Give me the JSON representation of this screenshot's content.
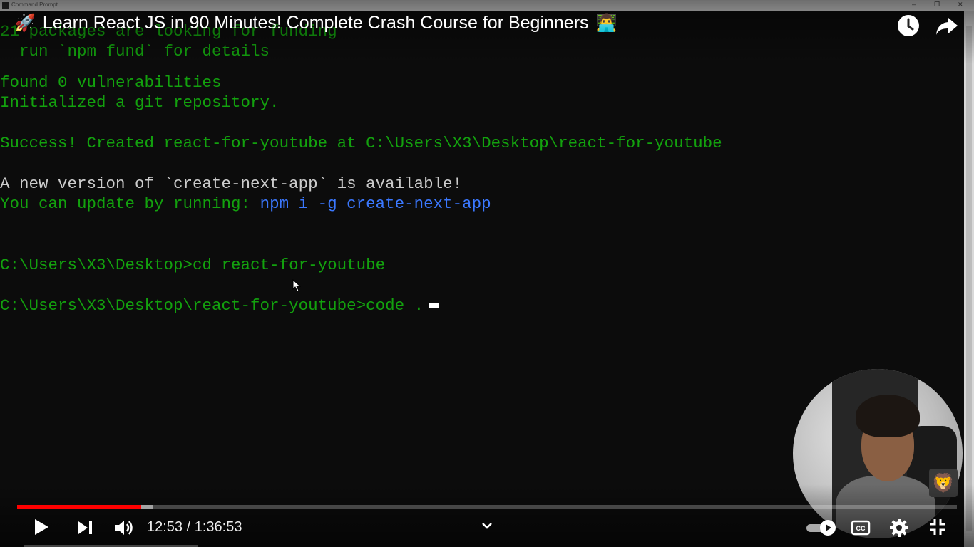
{
  "window": {
    "title": "Command Prompt",
    "buttons": [
      "–",
      "❐",
      "✕"
    ]
  },
  "terminal": {
    "lines": [
      {
        "text": "21 packages are looking for funding",
        "color": "green"
      },
      {
        "text": "  run `npm fund` for details",
        "color": "green"
      },
      {
        "text": "found 0 vulnerabilities",
        "color": "green"
      },
      {
        "text": "Initialized a git repository.",
        "color": "green"
      },
      {
        "text": "Success! Created react-for-youtube at C:\\Users\\X3\\Desktop\\react-for-youtube",
        "color": "green"
      },
      {
        "text": "A new version of `create-next-app` is available!",
        "color": "white"
      },
      {
        "text": "You can update by running: ",
        "color": "green",
        "extra": "npm i -g create-next-app"
      },
      {
        "text": "C:\\Users\\X3\\Desktop>cd react-for-youtube",
        "color": "green"
      },
      {
        "text": "C:\\Users\\X3\\Desktop\\react-for-youtube>code .",
        "color": "green"
      }
    ]
  },
  "player": {
    "title_emoji_left": "🚀",
    "title": "Learn React JS in 90 Minutes! Complete Crash Course for Beginners",
    "title_emoji_right": "👨‍💻",
    "time_current": "12:53",
    "time_separator": " / ",
    "time_total": "1:36:53",
    "progress_played_fraction": 0.132,
    "progress_buffered_fraction": 0.145,
    "channel_badge_emoji": "🦁",
    "icons": {
      "watch_later": "clock-icon",
      "share": "share-icon",
      "play": "play-icon",
      "next": "next-icon",
      "volume": "volume-icon",
      "chapters": "chevron-down-icon",
      "autoplay": "autoplay-toggle-icon",
      "captions": "cc-icon",
      "settings": "gear-icon",
      "exit_fullscreen": "exit-fullscreen-icon"
    },
    "accent_color": "#ff0000"
  }
}
